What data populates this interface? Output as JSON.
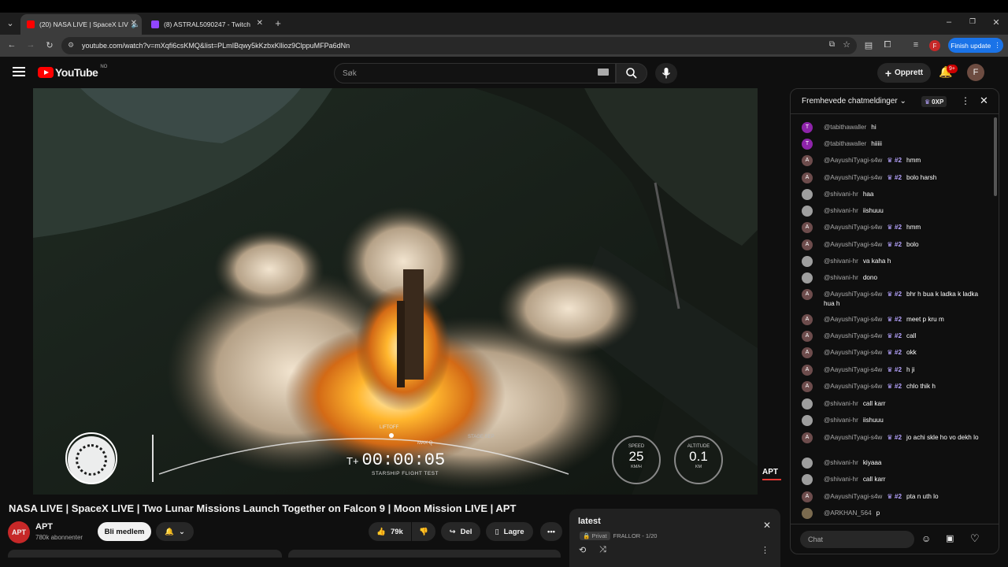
{
  "browser": {
    "tabs": [
      {
        "title": "(20) NASA LIVE | SpaceX LIV",
        "favicon_color": "#ff0000",
        "active": true
      },
      {
        "title": "(8) ASTRAL5090247 - Twitch",
        "favicon_color": "#9146ff",
        "active": false
      }
    ],
    "url": "youtube.com/watch?v=mXqfi6csKMQ&list=PLmIBqwy5kKzbxKllioz9ClppuMFPa6dNn",
    "finish_update": "Finish update",
    "profile_initial": "F"
  },
  "youtube": {
    "logo_text": "YouTube",
    "region": "NO",
    "search_placeholder": "Søk",
    "create_label": "Opprett",
    "notifications_badge": "9+",
    "avatar_initial": "F"
  },
  "video": {
    "overlay": {
      "timer_prefix": "T+",
      "timer": "00:00:05",
      "subtitle": "STARSHIP FLIGHT TEST",
      "speed_label": "SPEED",
      "speed_value": "25",
      "speed_unit": "KM/H",
      "altitude_label": "ALTITUDE",
      "altitude_value": "0.1",
      "altitude_unit": "KM",
      "liftoff": "LIFTOFF",
      "maxq": "MAX Q",
      "stage_sep": "STAGE SEP",
      "watermark": "APT"
    },
    "title": "NASA LIVE | SpaceX LIVE | Two Lunar Missions Launch Together on Falcon 9 | Moon Mission LIVE | APT",
    "channel": {
      "name": "APT",
      "subscribers": "780k abonnenter",
      "logo": "APT"
    },
    "join_label": "Bli medlem",
    "likes": "79k",
    "share_label": "Del",
    "save_label": "Lagre"
  },
  "chat": {
    "header": "Fremhevede chatmeldinger",
    "xp": "0XP",
    "input_placeholder": "Chat",
    "messages": [
      {
        "author": "@tabithawaller",
        "text": "hi",
        "initial": "T",
        "color": "#8e24aa",
        "badge": ""
      },
      {
        "author": "@tabithawaller",
        "text": "hiiiii",
        "initial": "T",
        "color": "#8e24aa",
        "badge": ""
      },
      {
        "author": "@AayushiTyagi-s4w",
        "text": "hmm",
        "initial": "A",
        "color": "#6d4c4c",
        "badge": "#2"
      },
      {
        "author": "@AayushiTyagi-s4w",
        "text": "bolo harsh",
        "initial": "A",
        "color": "#6d4c4c",
        "badge": "#2"
      },
      {
        "author": "@shivani-hr",
        "text": "haa",
        "initial": "",
        "color": "#9e9e9e",
        "badge": ""
      },
      {
        "author": "@shivani-hr",
        "text": "iishuuu",
        "initial": "",
        "color": "#9e9e9e",
        "badge": ""
      },
      {
        "author": "@AayushiTyagi-s4w",
        "text": "hmm",
        "initial": "A",
        "color": "#6d4c4c",
        "badge": "#2"
      },
      {
        "author": "@AayushiTyagi-s4w",
        "text": "bolo",
        "initial": "A",
        "color": "#6d4c4c",
        "badge": "#2"
      },
      {
        "author": "@shivani-hr",
        "text": "va kaha h",
        "initial": "",
        "color": "#9e9e9e",
        "badge": ""
      },
      {
        "author": "@shivani-hr",
        "text": "dono",
        "initial": "",
        "color": "#9e9e9e",
        "badge": ""
      },
      {
        "author": "@AayushiTyagi-s4w",
        "text": "bhr h bua k ladka k ladka hua h",
        "initial": "A",
        "color": "#6d4c4c",
        "badge": "#2"
      },
      {
        "author": "@AayushiTyagi-s4w",
        "text": "meet p kru m",
        "initial": "A",
        "color": "#6d4c4c",
        "badge": "#2"
      },
      {
        "author": "@AayushiTyagi-s4w",
        "text": "call",
        "initial": "A",
        "color": "#6d4c4c",
        "badge": "#2"
      },
      {
        "author": "@AayushiTyagi-s4w",
        "text": "okk",
        "initial": "A",
        "color": "#6d4c4c",
        "badge": "#2"
      },
      {
        "author": "@AayushiTyagi-s4w",
        "text": "h ji",
        "initial": "A",
        "color": "#6d4c4c",
        "badge": "#2"
      },
      {
        "author": "@AayushiTyagi-s4w",
        "text": "chlo thik h",
        "initial": "A",
        "color": "#6d4c4c",
        "badge": "#2"
      },
      {
        "author": "@shivani-hr",
        "text": "call karr",
        "initial": "",
        "color": "#9e9e9e",
        "badge": ""
      },
      {
        "author": "@shivani-hr",
        "text": "iishuuu",
        "initial": "",
        "color": "#9e9e9e",
        "badge": ""
      },
      {
        "author": "@AayushiTyagi-s4w",
        "text": "jo achi skle ho vo dekh lo",
        "initial": "A",
        "color": "#6d4c4c",
        "badge": "#2"
      },
      {
        "author": "@shivani-hr",
        "text": "kiyaaa",
        "initial": "",
        "color": "#9e9e9e",
        "badge": ""
      },
      {
        "author": "@shivani-hr",
        "text": "call karr",
        "initial": "",
        "color": "#9e9e9e",
        "badge": ""
      },
      {
        "author": "@AayushiTyagi-s4w",
        "text": "pta n uth lo",
        "initial": "A",
        "color": "#6d4c4c",
        "badge": "#2"
      },
      {
        "author": "@ARKHAN_564",
        "text": "p",
        "initial": "",
        "color": "#7a6a4f",
        "badge": ""
      }
    ]
  },
  "playlist": {
    "title": "latest",
    "privacy": "Privat",
    "meta": "FRALLOR - 1/20"
  }
}
